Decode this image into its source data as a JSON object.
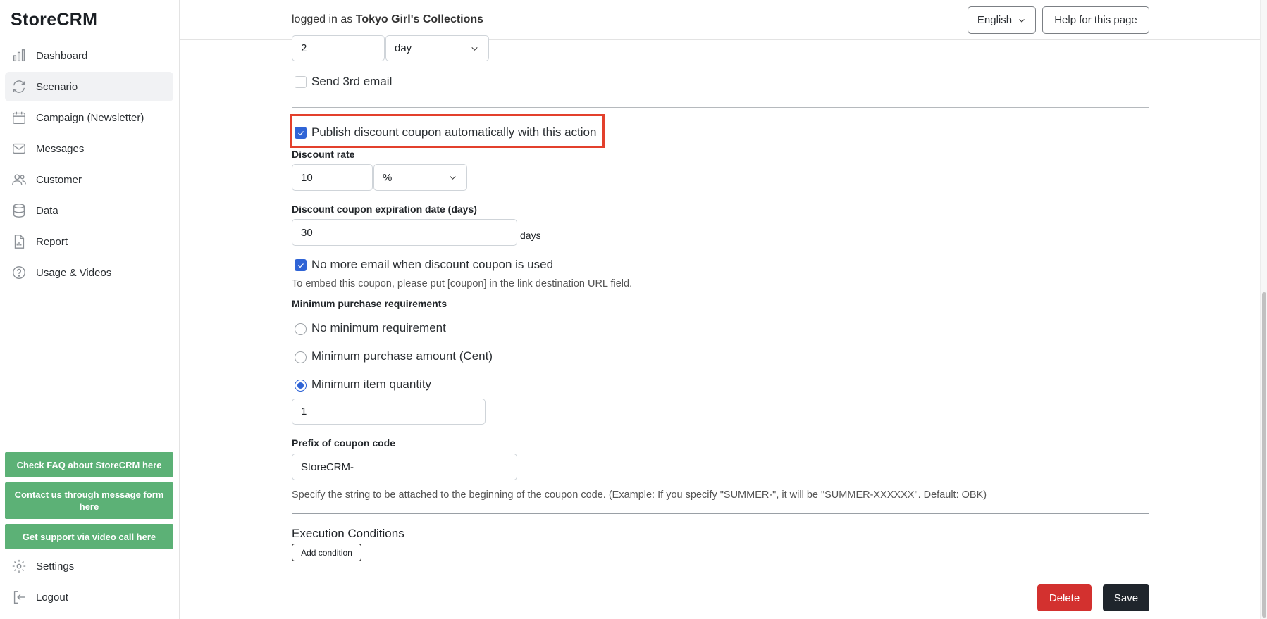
{
  "app": {
    "name": "StoreCRM"
  },
  "sidebar": {
    "items": [
      {
        "label": "Dashboard",
        "icon": "bar-chart-icon"
      },
      {
        "label": "Scenario",
        "icon": "refresh-icon"
      },
      {
        "label": "Campaign (Newsletter)",
        "icon": "calendar-icon"
      },
      {
        "label": "Messages",
        "icon": "envelope-icon"
      },
      {
        "label": "Customer",
        "icon": "users-icon"
      },
      {
        "label": "Data",
        "icon": "database-icon"
      },
      {
        "label": "Report",
        "icon": "document-chart-icon"
      },
      {
        "label": "Usage & Videos",
        "icon": "question-circle-icon"
      }
    ],
    "active_item": "Scenario",
    "support_buttons": [
      "Check FAQ about StoreCRM here",
      "Contact us through message form here",
      "Get support via video call here"
    ],
    "bottom_items": [
      {
        "label": "Settings",
        "icon": "gear-icon"
      },
      {
        "label": "Logout",
        "icon": "logout-icon"
      }
    ]
  },
  "header": {
    "logged_in_prefix": "logged in as",
    "store_name": "Tokyo Girl's Collections",
    "language": "English",
    "help_label": "Help for this page"
  },
  "form": {
    "interval_value": "2",
    "interval_unit": "day",
    "send_3rd_email_label": "Send 3rd email",
    "send_3rd_email_checked": false,
    "publish_coupon_label": "Publish discount coupon automatically with this action",
    "publish_coupon_checked": true,
    "discount_rate_label": "Discount rate",
    "discount_rate_value": "10",
    "discount_rate_unit": "%",
    "expiration_label": "Discount coupon expiration date (days)",
    "expiration_value": "30",
    "expiration_suffix": "days",
    "no_more_email_label": "No more email when discount coupon is used",
    "no_more_email_checked": true,
    "embed_hint": "To embed this coupon, please put [coupon] in the link destination URL field.",
    "min_purchase_label": "Minimum purchase requirements",
    "min_options": [
      "No minimum requirement",
      "Minimum purchase amount (Cent)",
      "Minimum item quantity"
    ],
    "min_selected": "Minimum item quantity",
    "min_quantity_value": "1",
    "prefix_label": "Prefix of coupon code",
    "prefix_value": "StoreCRM-",
    "prefix_hint": "Specify the string to be attached to the beginning of the coupon code. (Example: If you specify \"SUMMER-\", it will be \"SUMMER-XXXXXX\". Default: OBK)",
    "execution_title": "Execution Conditions",
    "add_condition_label": "Add condition"
  },
  "actions": {
    "delete_label": "Delete",
    "save_label": "Save"
  },
  "colors": {
    "accent": "#2f64d6",
    "support_green": "#5cb176",
    "delete_red": "#d3312f",
    "save_dark": "#1f252c",
    "highlight_red": "#e3402c"
  }
}
